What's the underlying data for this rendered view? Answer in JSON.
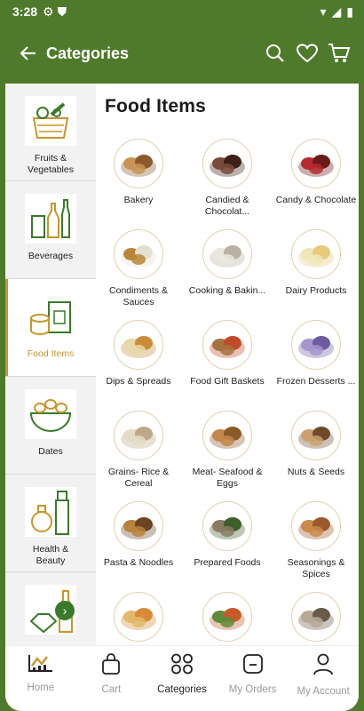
{
  "status": {
    "time": "3:28"
  },
  "appbar": {
    "title": "Categories"
  },
  "sidebar": {
    "items": [
      {
        "label": "Fruits &\nVegetables",
        "icon": "fruits-basket-icon"
      },
      {
        "label": "Beverages",
        "icon": "bottles-icon"
      },
      {
        "label": "Food Items",
        "icon": "can-box-icon",
        "active": true
      },
      {
        "label": "Dates",
        "icon": "dates-bowl-icon"
      },
      {
        "label": "Health &\nBeauty",
        "icon": "cosmetics-icon"
      },
      {
        "label": "",
        "icon": "gem-bottle-icon"
      }
    ]
  },
  "section": {
    "title": "Food Items"
  },
  "tiles": [
    {
      "label": "Bakery"
    },
    {
      "label": "Candied & Chocolat..."
    },
    {
      "label": "Candy & Chocolate"
    },
    {
      "label": "Condiments & Sauces"
    },
    {
      "label": "Cooking & Bakin..."
    },
    {
      "label": "Dairy Products"
    },
    {
      "label": "Dips & Spreads"
    },
    {
      "label": "Food Gift Baskets"
    },
    {
      "label": "Frozen Desserts ..."
    },
    {
      "label": "Grains- Rice & Cereal"
    },
    {
      "label": "Meat- Seafood & Eggs"
    },
    {
      "label": "Nuts & Seeds"
    },
    {
      "label": "Pasta & Noodles"
    },
    {
      "label": "Prepared Foods"
    },
    {
      "label": "Seasonings & Spices"
    },
    {
      "label": ""
    },
    {
      "label": ""
    },
    {
      "label": ""
    }
  ],
  "bottom_nav": [
    {
      "label": "Home"
    },
    {
      "label": "Cart"
    },
    {
      "label": "Categories",
      "active": true
    },
    {
      "label": "My Orders"
    },
    {
      "label": "My Account"
    }
  ],
  "colors": {
    "brand": "#4f7a2b",
    "accent": "#c8962a"
  }
}
